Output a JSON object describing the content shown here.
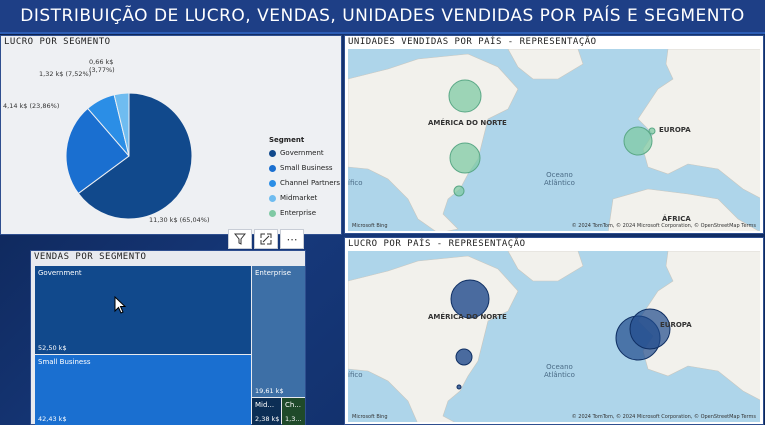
{
  "header": {
    "title": "DISTRIBUIÇÃO DE LUCRO, VENDAS, UNIDADES VENDIDAS POR PAÍS E SEGMENTO"
  },
  "pie": {
    "title": "LUCRO POR SEGMENTO",
    "legend_title": "Segment",
    "labels": [
      "11,30 k$ (65,04%)",
      "4,14 k$ (23,86%)",
      "1,32 k$ (7,52%)",
      "0,66 k$ (3,77%)"
    ],
    "legend": [
      "Government",
      "Small Business",
      "Channel Partners",
      "Midmarket",
      "Enterprise"
    ],
    "colors": [
      "#11498c",
      "#1a6fd0",
      "#2b8ee6",
      "#6fbcf0",
      "#7fc9a4"
    ]
  },
  "map_units": {
    "title": "UNIDADES VENDIDAS POR PAÍS - REPRESENTAÇÃO",
    "region_na": "AMÉRICA DO NORTE",
    "region_eu": "EUROPA",
    "region_af": "ÁFRICA",
    "sea": "Oceano\nAtlântico",
    "sea_left": "ífico",
    "credits": "© 2024 TomTom, © 2024 Microsoft Corporation, © OpenStreetMap  Terms",
    "bing": "Microsoft Bing"
  },
  "map_profit": {
    "title": "LUCRO POR PAÍS - REPRESENTAÇÃO",
    "region_na": "AMÉRICA DO NORTE",
    "region_eu": "EUROPA",
    "sea": "Oceano\nAtlântico",
    "sea_left": "ífico",
    "credits": "© 2024 TomTom, © 2024 Microsoft Corporation, © OpenStreetMap  Terms",
    "bing": "Microsoft Bing"
  },
  "treemap": {
    "title": "VENDAS POR SEGMENTO",
    "government": {
      "name": "Government",
      "value": "52,50 k$"
    },
    "small_business": {
      "name": "Small Business",
      "value": "42,43 k$"
    },
    "enterprise": {
      "name": "Enterprise",
      "value": "19,61 k$"
    },
    "midmarket": {
      "name": "Mid...",
      "value": "2,38 k$"
    },
    "channel": {
      "name": "Ch...",
      "value": "1,3..."
    }
  },
  "toolbar": {
    "filter_icon": "filter-icon",
    "focus_icon": "focus-mode-icon",
    "more_label": "⋯"
  },
  "chart_data": {
    "type": "pie",
    "title": "LUCRO POR SEGMENTO",
    "categories": [
      "Government",
      "Small Business",
      "Channel Partners",
      "Midmarket"
    ],
    "values": [
      11.3,
      4.14,
      1.32,
      0.66
    ],
    "percent": [
      65.04,
      23.86,
      7.52,
      3.77
    ],
    "unit": "k$"
  }
}
